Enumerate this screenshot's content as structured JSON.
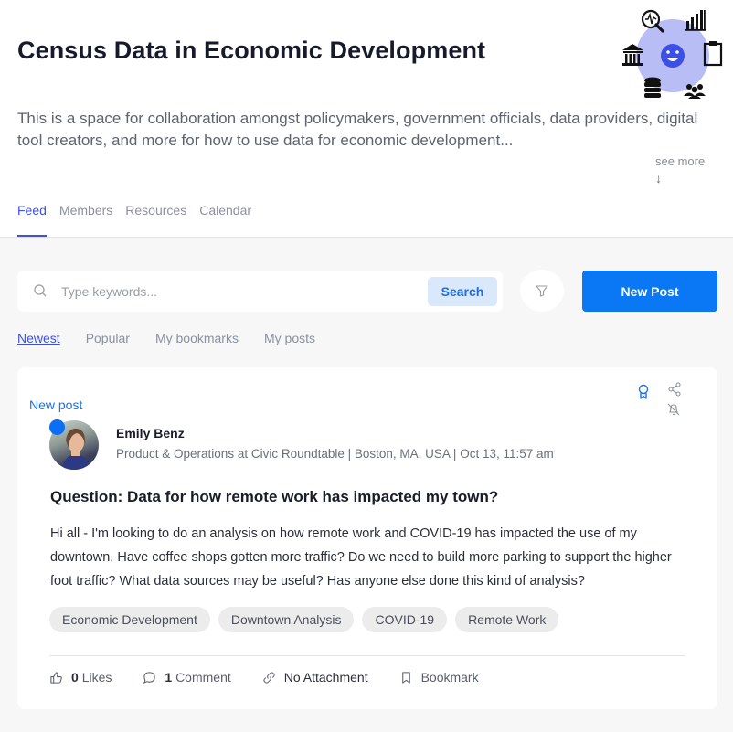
{
  "header": {
    "title": "Census Data in Economic Development",
    "description": "This is a space for collaboration amongst policymakers, government officials, data providers, digital tool creators, and more for how to use data for economic development...",
    "see_more": "see more",
    "see_more_arrow": "↓",
    "illustration_icons": [
      "search-chart-icon",
      "bar-chart-icon",
      "bank-icon",
      "smiley-icon",
      "clipboard-icon",
      "database-icon",
      "people-icon"
    ]
  },
  "tabs": [
    {
      "label": "Feed",
      "active": true
    },
    {
      "label": "Members",
      "active": false
    },
    {
      "label": "Resources",
      "active": false
    },
    {
      "label": "Calendar",
      "active": false
    }
  ],
  "search": {
    "placeholder": "Type keywords...",
    "value": "",
    "button_label": "Search"
  },
  "new_post_label": "New Post",
  "sort_tabs": [
    {
      "label": "Newest",
      "active": true
    },
    {
      "label": "Popular",
      "active": false
    },
    {
      "label": "My bookmarks",
      "active": false
    },
    {
      "label": "My posts",
      "active": false
    }
  ],
  "post": {
    "badge": "New post",
    "author": "Emily Benz",
    "meta": "Product & Operations at Civic Roundtable | Boston, MA, USA | Oct 13, 11:57 am",
    "title": "Question: Data for how remote work has impacted my town?",
    "body": "Hi all - I'm looking to do an analysis on how remote work and COVID-19 has impacted the use of my downtown. Have coffee shops gotten more traffic? Do we need to build more parking to support the higher foot traffic? What data sources may be useful? Has anyone else done this kind of analysis?",
    "tags": [
      "Economic Development",
      "Downtown Analysis",
      "COVID-19",
      "Remote Work"
    ],
    "likes_count": "0",
    "likes_label": "Likes",
    "comments_count": "1",
    "comments_label": "Comment",
    "attachment_label": "No Attachment",
    "bookmark_label": "Bookmark"
  },
  "colors": {
    "accent": "#3f51e0",
    "primary_button": "#0a78f5",
    "search_button_bg": "#d9e8fb",
    "new_post_dot": "#0a6ff5",
    "illustration_circle": "#b8bdf5",
    "smiley": "#3c4fe6"
  }
}
